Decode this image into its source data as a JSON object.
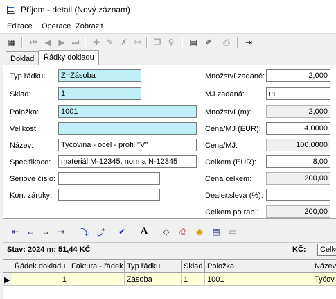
{
  "window": {
    "title": "Příjem - detail (Nový záznam)",
    "icon": "form-icon"
  },
  "menu": [
    {
      "label": "Editace"
    },
    {
      "label": "Operace"
    },
    {
      "label": "Zobrazit"
    }
  ],
  "tabs": [
    {
      "label": "Doklad",
      "active": false
    },
    {
      "label": "Řádky dokladu",
      "active": true
    }
  ],
  "form_left": [
    {
      "label": "Typ řádku:",
      "value": "Z=Zásoba"
    },
    {
      "label": "Sklad:",
      "value": "1"
    },
    {
      "label": "Položka:",
      "value": "1001"
    },
    {
      "label": "Velikost",
      "value": ""
    },
    {
      "label": "Název:",
      "value": "Tyčovina - ocel - profil \"V\""
    },
    {
      "label": "Specifikace:",
      "value": "materiál M-12345, norma N-12345"
    },
    {
      "label": "Sériové číslo:",
      "value": ""
    },
    {
      "label": "Kon. záruky:",
      "value": ""
    }
  ],
  "form_right": [
    {
      "label": "Množství zadané:",
      "value": "2,000"
    },
    {
      "label": "MJ zadaná:",
      "value": "m"
    },
    {
      "label": "Množství (m):",
      "value": "2,000"
    },
    {
      "label": "Cena/MJ (EUR):",
      "value": "4,0000"
    },
    {
      "label": "Cena/MJ:",
      "value": "100,0000"
    },
    {
      "label": "Celkem (EUR):",
      "value": "8,00"
    },
    {
      "label": "Cena celkem:",
      "value": "200,00"
    },
    {
      "label": "Dealer.sleva (%):",
      "value": ""
    },
    {
      "label": "Celkem po rab.:",
      "value": "200,00"
    }
  ],
  "status": {
    "text": "Stav: 2024 m; 51,44 KČ",
    "kc_label": "KČ:",
    "kc_value": "Celke"
  },
  "grid": {
    "columns": [
      "Řádek dokladu",
      "Faktura - řádek",
      "Typ řádku",
      "Sklad",
      "Položka",
      "Název"
    ],
    "rows": [
      [
        "1",
        "",
        "Zásoba",
        "1",
        "1001",
        "Tyčov"
      ]
    ]
  },
  "colors": {
    "required_field": "#bff0f7",
    "selected_row": "#ffffd8"
  }
}
